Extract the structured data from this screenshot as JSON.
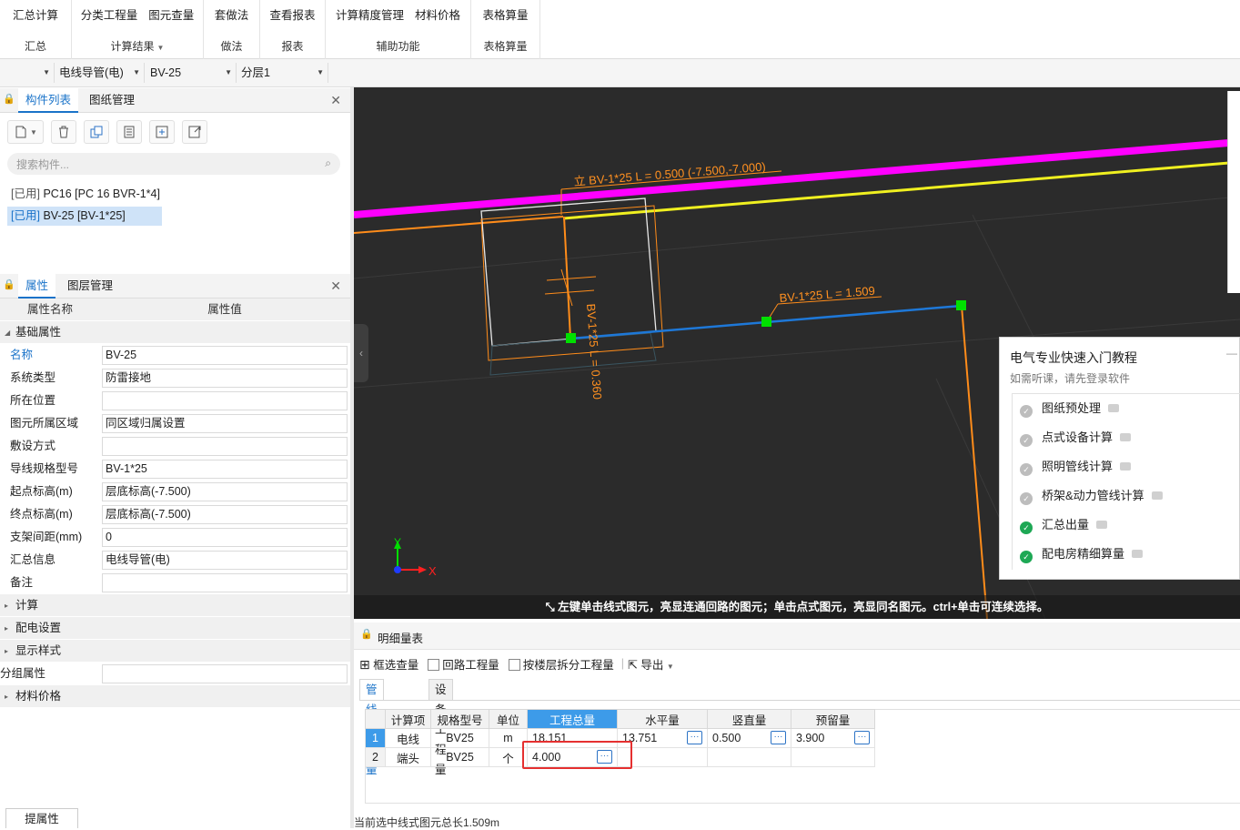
{
  "ribbon": {
    "groups": [
      {
        "buttons": [
          "汇总计算"
        ],
        "label": "汇总"
      },
      {
        "buttons": [
          "分类工程量",
          "图元查量"
        ],
        "label": "计算结果"
      },
      {
        "buttons": [
          "套做法"
        ],
        "label": "做法"
      },
      {
        "buttons": [
          "查看报表"
        ],
        "label": "报表"
      },
      {
        "buttons": [
          "计算精度管理",
          "材料价格"
        ],
        "label": "辅助功能"
      },
      {
        "buttons": [
          "表格算量"
        ],
        "label": "表格算量"
      }
    ]
  },
  "selectors": {
    "s1": "",
    "s2": "电线导管(电)",
    "s3": "BV-25",
    "s4": "分层1"
  },
  "component_panel": {
    "tabs": [
      "构件列表",
      "图纸管理"
    ],
    "search_placeholder": "搜索构件...",
    "items": [
      {
        "tag": "[已用]",
        "text": "PC16 [PC 16 BVR-1*4]"
      },
      {
        "tag": "[已用]",
        "text": "BV-25 [BV-1*25]"
      }
    ]
  },
  "property_panel": {
    "tabs": [
      "属性",
      "图层管理"
    ],
    "header_name": "属性名称",
    "header_value": "属性值",
    "group_basic": "基础属性",
    "rows": [
      {
        "name": "名称",
        "value": "BV-25"
      },
      {
        "name": "系统类型",
        "value": "防雷接地"
      },
      {
        "name": "所在位置",
        "value": ""
      },
      {
        "name": "图元所属区域",
        "value": "同区域归属设置"
      },
      {
        "name": "敷设方式",
        "value": ""
      },
      {
        "name": "导线规格型号",
        "value": "BV-1*25"
      },
      {
        "name": "起点标高(m)",
        "value": "层底标高(-7.500)"
      },
      {
        "name": "终点标高(m)",
        "value": "层底标高(-7.500)"
      },
      {
        "name": "支架间距(mm)",
        "value": "0"
      },
      {
        "name": "汇总信息",
        "value": "电线导管(电)"
      },
      {
        "name": "备注",
        "value": ""
      }
    ],
    "groups_after": [
      "计算",
      "配电设置",
      "显示样式"
    ],
    "group_attr_label": "分组属性",
    "group_material": "材料价格",
    "bottom_tab": "提属性"
  },
  "canvas": {
    "label_vertical_top": "立 BV-1*25 L = 0.500 (-7.500,-7.000)",
    "label_blue": "BV-1*25 L = 1.509",
    "label_rotated": "BV-1*25 L = 0.360",
    "axis_x": "X",
    "axis_y": "Y",
    "status_message": "左键单击线式图元，亮显连通回路的图元；单击点式图元，亮显同名图元。ctrl+单击可连续选择。",
    "colors": {
      "magenta": "#ff00ff",
      "yellow": "#f0f020",
      "orange": "#ff8c1a",
      "blue": "#1e78d8",
      "green": "#00e000"
    }
  },
  "tutorial": {
    "title": "电气专业快速入门教程",
    "subtitle": "如需听课，请先登录软件",
    "items": [
      {
        "label": "图纸预处理",
        "done": false
      },
      {
        "label": "点式设备计算",
        "done": false
      },
      {
        "label": "照明管线计算",
        "done": false
      },
      {
        "label": "桥架&动力管线计算",
        "done": false
      },
      {
        "label": "汇总出量",
        "done": true
      },
      {
        "label": "配电房精细算量",
        "done": true
      }
    ]
  },
  "detail": {
    "title": "明细量表",
    "tools": {
      "box_select": "框选查量",
      "loop": "回路工程量",
      "floor_split": "按楼层拆分工程量",
      "export": "导出"
    },
    "tabs": [
      "管线工程量",
      "设备工程量"
    ],
    "columns": [
      "",
      "计算项",
      "规格型号",
      "单位",
      "工程总量",
      "水平量",
      "竖直量",
      "预留量"
    ],
    "rows": [
      {
        "n": "1",
        "item": "电线",
        "spec": "BV25",
        "unit": "m",
        "total": "18.151",
        "horizontal": "13.751",
        "vertical": "0.500",
        "reserve": "3.900"
      },
      {
        "n": "2",
        "item": "端头",
        "spec": "BV25",
        "unit": "个",
        "total": "4.000",
        "horizontal": "",
        "vertical": "",
        "reserve": ""
      }
    ]
  },
  "status_bar": "当前选中线式图元总长1.509m"
}
